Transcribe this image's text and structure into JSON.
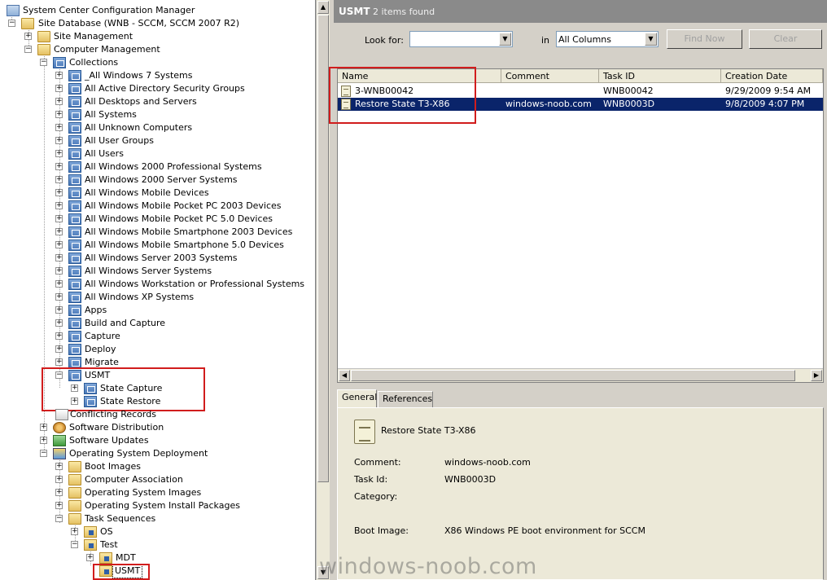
{
  "tree": {
    "root": "System Center Configuration Manager",
    "site_db": "Site Database  (WNB - SCCM, SCCM 2007 R2)",
    "site_mgmt": "Site Management",
    "comp_mgmt": "Computer Management",
    "collections": "Collections",
    "collection_items": [
      "_All Windows 7 Systems",
      "All Active Directory Security Groups",
      "All Desktops and Servers",
      "All Systems",
      "All Unknown Computers",
      "All User Groups",
      "All Users",
      "All Windows 2000 Professional Systems",
      "All Windows 2000 Server Systems",
      "All Windows Mobile Devices",
      "All Windows Mobile Pocket PC 2003 Devices",
      "All Windows Mobile Pocket PC 5.0 Devices",
      "All Windows Mobile Smartphone 2003 Devices",
      "All Windows Mobile Smartphone 5.0 Devices",
      "All Windows Server 2003 Systems",
      "All Windows Server Systems",
      "All Windows Workstation or Professional Systems",
      "All Windows XP Systems",
      "Apps",
      "Build and Capture",
      "Capture",
      "Deploy",
      "Migrate"
    ],
    "usmt": "USMT",
    "usmt_children": [
      "State Capture",
      "State Restore"
    ],
    "conflicting": "Conflicting Records",
    "software_distribution": "Software Distribution",
    "software_updates": "Software Updates",
    "osd": "Operating System Deployment",
    "osd_items": [
      "Boot Images",
      "Computer Association",
      "Operating System Images",
      "Operating System Install Packages"
    ],
    "task_sequences": "Task Sequences",
    "ts_os": "OS",
    "ts_test": "Test",
    "ts_mdt": "MDT",
    "ts_usmt": "USMT"
  },
  "header": {
    "title": "USMT",
    "count": "2 items found"
  },
  "search": {
    "look_for_label": "Look for:",
    "look_for_value": "",
    "in_label": "in",
    "in_value": "All Columns",
    "find_now": "Find Now",
    "clear": "Clear"
  },
  "list": {
    "columns": [
      "Name",
      "Comment",
      "Task ID",
      "Creation Date"
    ],
    "rows": [
      {
        "name": "3-WNB00042",
        "comment": "",
        "task_id": "WNB00042",
        "date": "9/29/2009 9:54 AM"
      },
      {
        "name": "Restore State T3-X86",
        "comment": "windows-noob.com",
        "task_id": "WNB0003D",
        "date": "9/8/2009 4:07 PM"
      }
    ]
  },
  "tabs": [
    "General",
    "References"
  ],
  "details": {
    "title": "Restore State T3-X86",
    "comment_label": "Comment:",
    "comment_value": "windows-noob.com",
    "taskid_label": "Task Id:",
    "taskid_value": "WNB0003D",
    "category_label": "Category:",
    "category_value": "",
    "boot_label": "Boot Image:",
    "boot_value": "X86 Windows PE boot environment for SCCM"
  },
  "watermark": "windows-noob.com",
  "colors": {
    "selection": "#0a246a",
    "highlight_box": "#d11d1d",
    "header_bar": "#8a8a8a"
  }
}
